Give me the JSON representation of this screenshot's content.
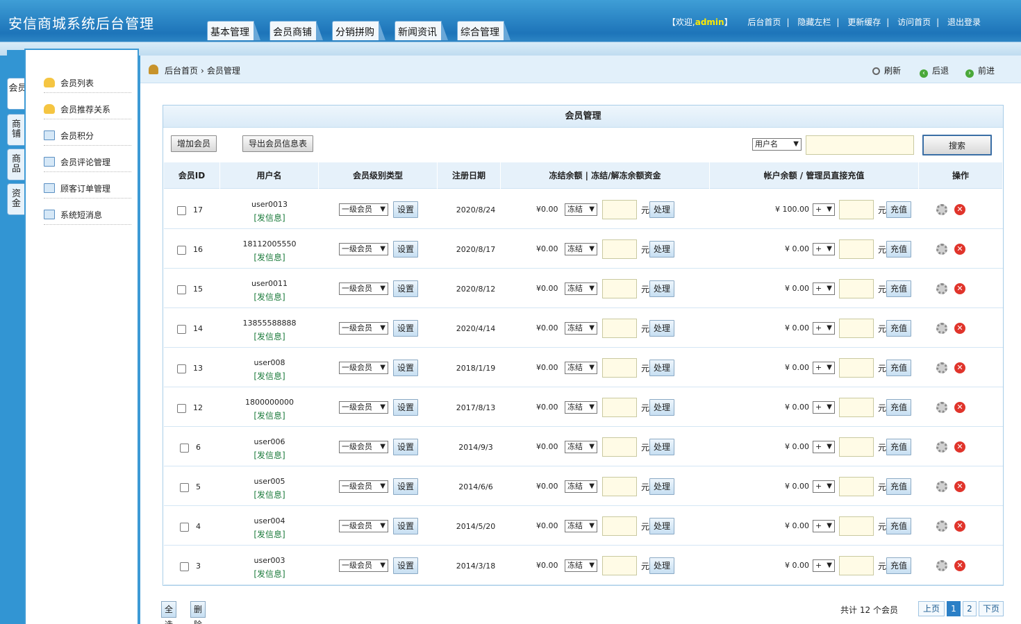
{
  "app_title": "安信商城系统后台管理",
  "tabs": [
    "基本管理",
    "会员商铺",
    "分销拼购",
    "新闻资讯",
    "综合管理"
  ],
  "top": {
    "welcome_prefix": "【欢迎,",
    "user": "admin",
    "welcome_suffix": "】",
    "links": [
      "后台首页",
      "隐藏左栏",
      "更新缓存",
      "访问首页",
      "退出登录"
    ],
    "separator": "|"
  },
  "vtabs": [
    "会员",
    "商铺",
    "商品",
    "资金"
  ],
  "sidebar": [
    {
      "label": "会员列表",
      "icon": "user-edit-icon"
    },
    {
      "label": "会员推荐关系",
      "icon": "user-edit-icon"
    },
    {
      "label": "会员积分",
      "icon": "folder-icon"
    },
    {
      "label": "会员评论管理",
      "icon": "folder-icon"
    },
    {
      "label": "顾客订单管理",
      "icon": "folder-icon"
    },
    {
      "label": "系统短消息",
      "icon": "folder-icon"
    }
  ],
  "breadcrumb": {
    "home": "后台首页",
    "sep": "›",
    "current": "会员管理"
  },
  "toolbar": {
    "refresh": "刷新",
    "back": "后退",
    "forward": "前进"
  },
  "panel": {
    "title": "会员管理",
    "add_btn": "增加会员",
    "export_btn": "导出会员信息表",
    "search_field": "用户名",
    "search_btn": "搜索"
  },
  "columns": [
    "会员ID",
    "用户名",
    "会员级别类型",
    "注册日期",
    "冻结余额 | 冻结/解冻余额资金",
    "帐户余额 / 管理员直接充值",
    "操作"
  ],
  "row_labels": {
    "send_msg": "[发信息]",
    "level": "一级会员",
    "set_btn": "设置",
    "frozen_prefix": "¥0.00",
    "freeze_option": "冻结",
    "yuan": "元",
    "process_btn": "处理",
    "plus_option": "+",
    "recharge_btn": "充值"
  },
  "members": [
    {
      "id": "17",
      "username": "user0013",
      "date": "2020/8/24",
      "balance": "¥ 100.00"
    },
    {
      "id": "16",
      "username": "18112005550",
      "date": "2020/8/17",
      "balance": "¥ 0.00"
    },
    {
      "id": "15",
      "username": "user0011",
      "date": "2020/8/12",
      "balance": "¥ 0.00"
    },
    {
      "id": "14",
      "username": "13855588888",
      "date": "2020/4/14",
      "balance": "¥ 0.00"
    },
    {
      "id": "13",
      "username": "user008",
      "date": "2018/1/19",
      "balance": "¥ 0.00"
    },
    {
      "id": "12",
      "username": "1800000000",
      "date": "2017/8/13",
      "balance": "¥ 0.00"
    },
    {
      "id": "6",
      "username": "user006",
      "date": "2014/9/3",
      "balance": "¥ 0.00"
    },
    {
      "id": "5",
      "username": "user005",
      "date": "2014/6/6",
      "balance": "¥ 0.00"
    },
    {
      "id": "4",
      "username": "user004",
      "date": "2014/5/20",
      "balance": "¥ 0.00"
    },
    {
      "id": "3",
      "username": "user003",
      "date": "2014/3/18",
      "balance": "¥ 0.00"
    }
  ],
  "footer": {
    "select_all": "全选",
    "delete": "删除",
    "total_prefix": "共计",
    "total": "12",
    "total_suffix": "个会员",
    "prev": "上页",
    "pages": [
      "1",
      "2"
    ],
    "next": "下页"
  }
}
